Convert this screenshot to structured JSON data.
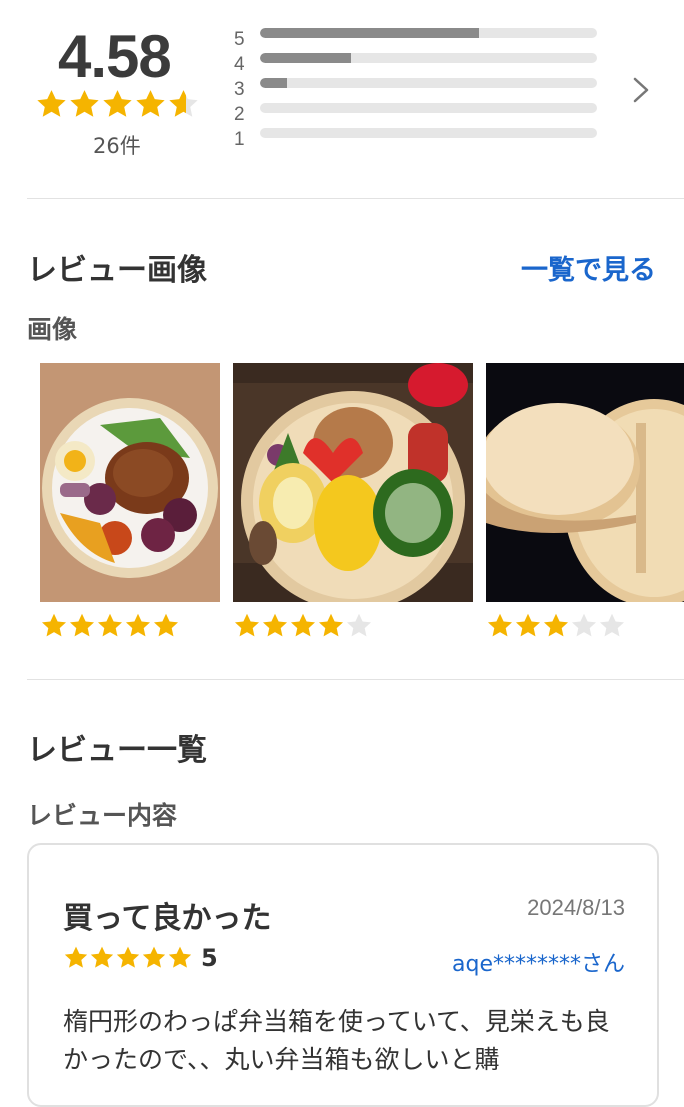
{
  "summary": {
    "average": "4.58",
    "average_stars": 4.58,
    "count": "26件",
    "distribution": [
      {
        "label": "5",
        "fraction": 0.65
      },
      {
        "label": "4",
        "fraction": 0.27
      },
      {
        "label": "3",
        "fraction": 0.08
      },
      {
        "label": "2",
        "fraction": 0.0
      },
      {
        "label": "1",
        "fraction": 0.0
      }
    ]
  },
  "review_images": {
    "title": "レビュー画像",
    "see_all": "一覧で見る",
    "subtitle": "画像",
    "items": [
      {
        "stars": 5
      },
      {
        "stars": 4
      },
      {
        "stars": 3
      }
    ]
  },
  "review_list": {
    "title": "レビュー一覧",
    "subtitle": "レビュー内容",
    "review": {
      "title": "買って良かった",
      "date": "2024/8/13",
      "stars": 5,
      "rating": "5",
      "user": "aqe********さん",
      "body": "楕円形のわっぱ弁当箱を使っていて、見栄えも良かったので、、丸い弁当箱も欲しいと購"
    }
  },
  "colors": {
    "star": "#f5b400",
    "star_empty": "#e6e6e6",
    "link": "#1a66cc",
    "bar_fill": "#8a8a8a"
  }
}
